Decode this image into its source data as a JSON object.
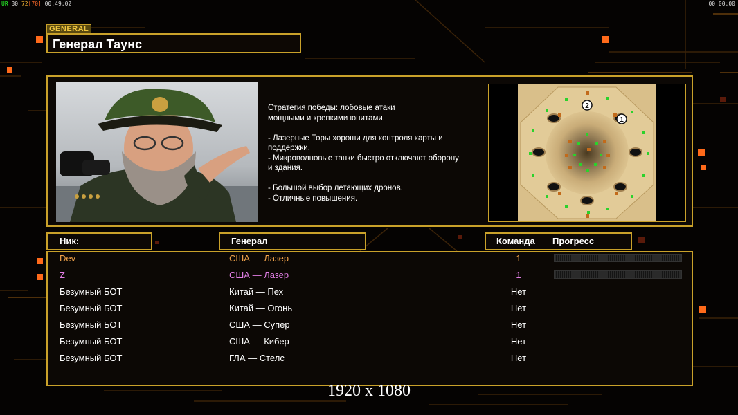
{
  "hud": {
    "left_part1": "UR",
    "left_part2": "30",
    "left_part3": "72",
    "left_part4": "[70]",
    "left_time": "00:49:02",
    "right_time": "00:00:00"
  },
  "general": {
    "tag": "GENERAL",
    "name": "Генерал Таунс",
    "description": "Стратегия победы: лобовые атаки\nмощными и крепкими юнитами.\n\n- Лазерные Торы хороши для контроля карты и\n поддержки.\n- Микроволновые танки быстро отключают оборону\n и здания.\n\n- Большой выбор летающих дронов.\n- Отличные повышения."
  },
  "minimap": {
    "start_labels": [
      "2",
      "1"
    ]
  },
  "table": {
    "headers": {
      "nick": "Ник:",
      "general": "Генерал",
      "team": "Команда",
      "progress": "Прогресс"
    },
    "rows": [
      {
        "nick": "Dev",
        "general": "США — Лазер",
        "team": "1",
        "color": "#f0a24a",
        "progress": 0
      },
      {
        "nick": "Z",
        "general": "США — Лазер",
        "team": "1",
        "color": "#e27fe6",
        "progress": 0
      },
      {
        "nick": "Безумный БОТ",
        "general": "Китай — Пех",
        "team": "Нет",
        "color": "#ffffff"
      },
      {
        "nick": "Безумный БОТ",
        "general": "Китай — Огонь",
        "team": "Нет",
        "color": "#ffffff"
      },
      {
        "nick": "Безумный БОТ",
        "general": "США — Супер",
        "team": "Нет",
        "color": "#ffffff"
      },
      {
        "nick": "Безумный БОТ",
        "general": "США — Кибер",
        "team": "Нет",
        "color": "#ffffff"
      },
      {
        "nick": "Безумный БОТ",
        "general": "ГЛА — Стелс",
        "team": "Нет",
        "color": "#ffffff"
      }
    ]
  },
  "resolution_text": "1920 x 1080",
  "colors": {
    "accent_gold": "#c9a12a",
    "glow_orange": "#ff6a1a"
  }
}
